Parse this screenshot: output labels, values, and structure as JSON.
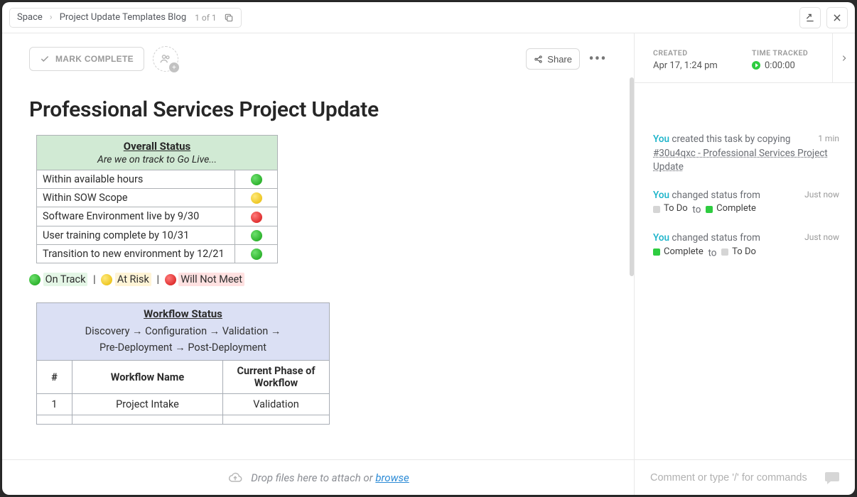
{
  "breadcrumb": {
    "root": "Space",
    "leaf": "Project Update Templates Blog",
    "count": "1 of 1"
  },
  "toolbar": {
    "mark_complete": "MARK COMPLETE",
    "share": "Share"
  },
  "meta": {
    "created_label": "CREATED",
    "created_value": "Apr 17, 1:24 pm",
    "time_label": "TIME TRACKED",
    "time_value": "0:00:00"
  },
  "title": "Professional Services Project Update",
  "overall": {
    "header": "Overall Status",
    "sub": "Are we on track to Go Live...",
    "rows": [
      {
        "label": "Within available hours",
        "status": "green"
      },
      {
        "label": "Within SOW Scope",
        "status": "yellow"
      },
      {
        "label": "Software Environment live by 9/30",
        "status": "red"
      },
      {
        "label": "User training complete by 10/31",
        "status": "green"
      },
      {
        "label": "Transition to new environment by 12/21",
        "status": "green"
      }
    ]
  },
  "legend": {
    "on_track": "On Track",
    "at_risk": "At Risk",
    "will_not_meet": "Will Not Meet"
  },
  "workflow": {
    "header": "Workflow Status",
    "sub_line1": "Discovery  →  Configuration  →  Validation  →",
    "sub_line2": "Pre-Deployment  →  Post-Deployment",
    "col1": "#",
    "col2": "Workflow Name",
    "col3": "Current Phase of Workflow",
    "rows": [
      {
        "num": "1",
        "name": "Project Intake",
        "phase": "Validation"
      }
    ]
  },
  "attach": {
    "text": "Drop files here to attach or ",
    "link": "browse"
  },
  "activity": {
    "items": [
      {
        "time": "1 min",
        "actor": "You",
        "verb": " created this task by copying  ",
        "link": "#30u4qxc - Professional Services Project Update"
      },
      {
        "time": "Just now",
        "actor": "You",
        "verb": " changed status from",
        "from_label": "To Do",
        "from_color": "grey",
        "to_label": "Complete",
        "to_color": "green"
      },
      {
        "time": "Just now",
        "actor": "You",
        "verb": " changed status from",
        "from_label": "Complete",
        "from_color": "green",
        "to_label": "To Do",
        "to_color": "grey"
      }
    ]
  },
  "comment": {
    "placeholder": "Comment or type '/' for commands"
  }
}
